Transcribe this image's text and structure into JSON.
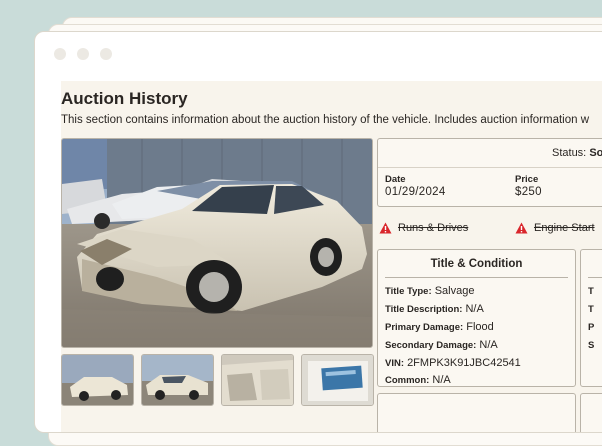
{
  "section": {
    "title": "Auction History",
    "description": "This section contains information about the auction history of the vehicle. Includes auction information w"
  },
  "status": {
    "label": "Status:",
    "value": "So"
  },
  "sale": {
    "date_label": "Date",
    "date_value": "01/29/2024",
    "price_label": "Price",
    "price_value": "$250"
  },
  "warnings": [
    {
      "text": "Runs & Drives",
      "icon": "warning-triangle-icon",
      "color": "#d9262c"
    },
    {
      "text": "Engine Start",
      "icon": "warning-triangle-icon",
      "color": "#d9262c"
    }
  ],
  "title_condition": {
    "heading": "Title & Condition",
    "rows": [
      {
        "key": "Title Type:",
        "value": "Salvage"
      },
      {
        "key": "Title Description:",
        "value": "N/A"
      },
      {
        "key": "Primary Damage:",
        "value": "Flood"
      },
      {
        "key": "Secondary Damage:",
        "value": "N/A"
      },
      {
        "key": "VIN:",
        "value": "2FMPK3K91JBC42541"
      },
      {
        "key": "Common:",
        "value": "N/A"
      }
    ]
  },
  "side_panel": {
    "rows": [
      "T",
      "T",
      "P",
      "S"
    ]
  },
  "colors": {
    "page_background": "#c9dcd9",
    "content_background": "#f8f4ec",
    "warning_red": "#d9262c",
    "text": "#2a2623"
  }
}
